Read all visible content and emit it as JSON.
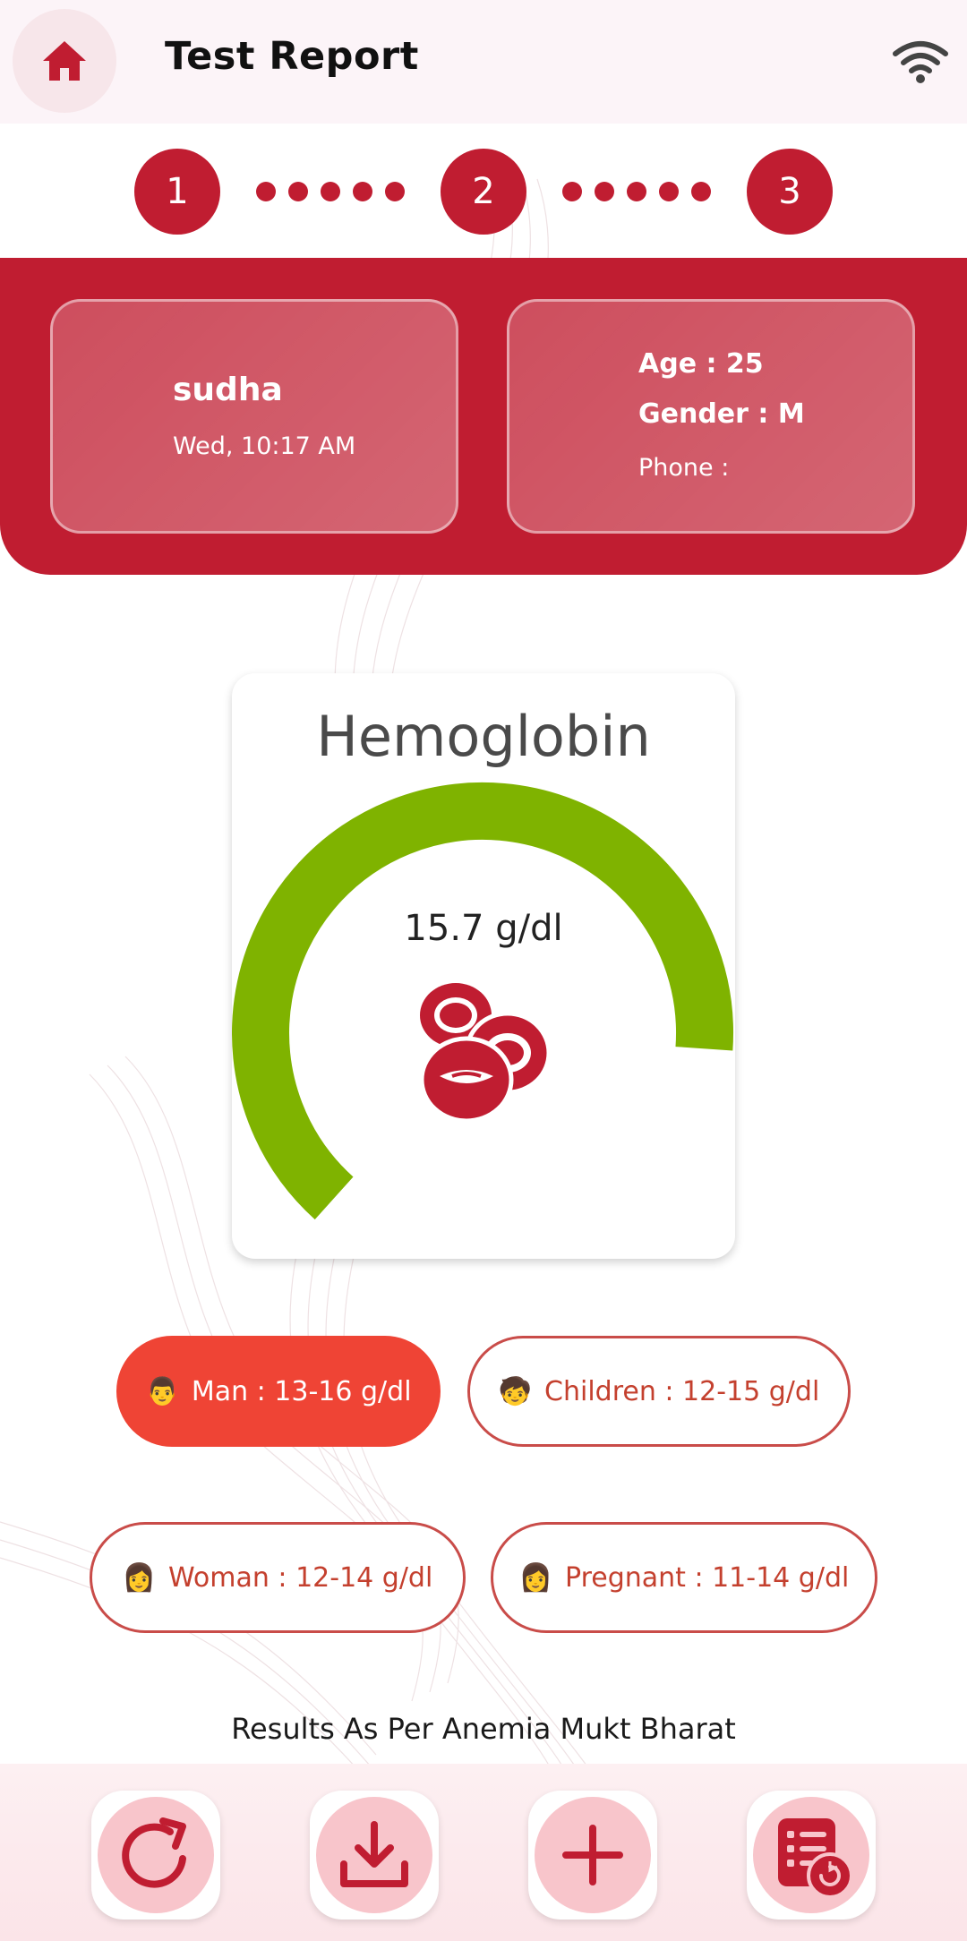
{
  "header": {
    "title": "Test Report",
    "home_icon": "home-icon",
    "status_icon": "wifi-icon"
  },
  "stepper": {
    "steps": [
      "1",
      "2",
      "3"
    ],
    "dots_between": 5
  },
  "patient": {
    "name": "sudha",
    "datetime": "Wed, 10:17 AM",
    "age": "Age : 25",
    "gender": "Gender : M",
    "phone": "Phone :"
  },
  "gauge": {
    "title": "Hemoglobin",
    "value_text": "15.7 g/dl",
    "icon": "blood-cells-icon",
    "fill_fraction": 1.0
  },
  "ranges": {
    "man": {
      "emoji": "👨",
      "label": "Man : 13-16 g/dl",
      "active": true
    },
    "children": {
      "emoji": "🧒",
      "label": "Children : 12-15 g/dl",
      "active": false
    },
    "woman": {
      "emoji": "👩",
      "label": "Woman : 12-14 g/dl",
      "active": false
    },
    "pregnant": {
      "emoji": "👩",
      "label": "Pregnant : 11-14 g/dl",
      "active": false
    }
  },
  "footnote": "Results As Per Anemia Mukt Bharat",
  "actions": [
    "refresh-icon",
    "download-icon",
    "add-icon",
    "report-history-icon"
  ],
  "colors": {
    "brand_red": "#c01d31",
    "gauge_green": "#7fb300",
    "chip_active": "#ef4435",
    "chip_text": "#c4402e"
  }
}
